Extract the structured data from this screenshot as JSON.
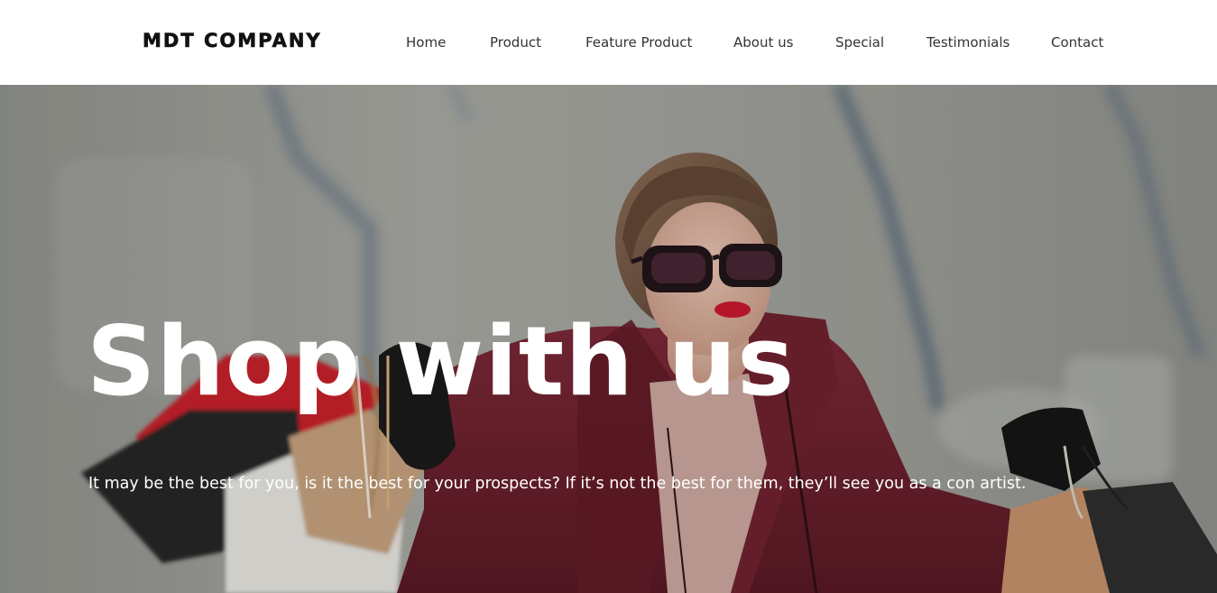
{
  "header": {
    "brand": "MDT COMPANY",
    "nav": [
      {
        "label": "Home"
      },
      {
        "label": "Product"
      },
      {
        "label": "Feature Product"
      },
      {
        "label": "About us"
      },
      {
        "label": "Special"
      },
      {
        "label": "Testimonials"
      },
      {
        "label": "Contact"
      }
    ]
  },
  "hero": {
    "title": "Shop with us",
    "subtitle": "It may be the best for you, is it the best for your prospects? If it’s not the best for them, they’ll see you as a con artist.",
    "image": "woman-with-shopping-bags-photo"
  },
  "colors": {
    "header_bg": "#ffffff",
    "brand_text": "#111111",
    "nav_text": "#333333",
    "hero_text": "#ffffff",
    "coat": "#6b1c2a",
    "lipstick": "#c8142a"
  }
}
